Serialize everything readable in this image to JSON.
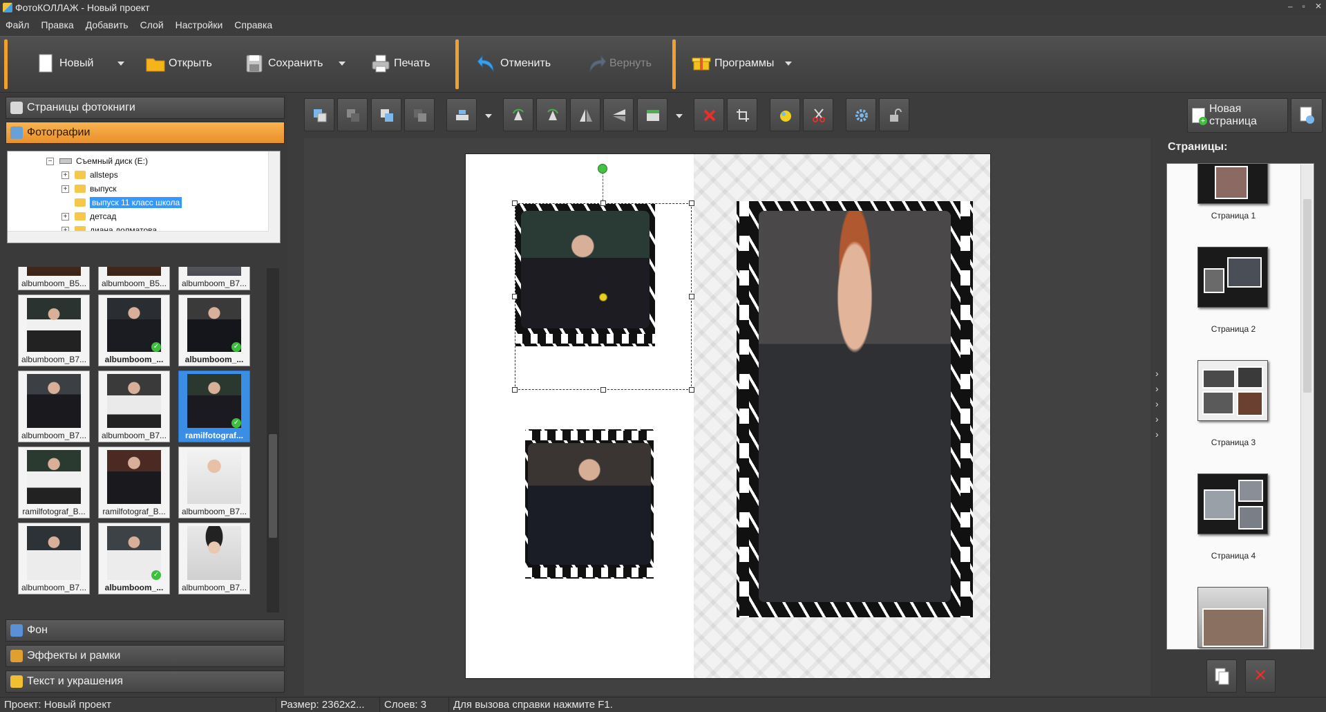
{
  "window": {
    "title": "ФотоКОЛЛАЖ - Новый проект"
  },
  "menu": [
    "Файл",
    "Правка",
    "Добавить",
    "Слой",
    "Настройки",
    "Справка"
  ],
  "toolbar": {
    "new": "Новый",
    "open": "Открыть",
    "save": "Сохранить",
    "print": "Печать",
    "undo": "Отменить",
    "redo": "Вернуть",
    "programs": "Программы"
  },
  "left_panel": {
    "sections": {
      "pages": "Страницы фотокниги",
      "photos": "Фотографии",
      "background": "Фон",
      "effects": "Эффекты и рамки",
      "text": "Текст и украшения"
    },
    "tree": [
      {
        "label": "Съемный диск (E:)",
        "type": "drive",
        "expand": "−"
      },
      {
        "label": "allsteps",
        "type": "folder",
        "expand": "+"
      },
      {
        "label": "выпуск",
        "type": "folder",
        "expand": "+"
      },
      {
        "label": "выпуск 11 класс школа",
        "type": "folder",
        "expand": "",
        "selected": true
      },
      {
        "label": "детсад",
        "type": "folder",
        "expand": "+"
      },
      {
        "label": "диана долматова",
        "type": "folder",
        "expand": "+"
      }
    ],
    "thumbnails": [
      {
        "caption": "albumboom_B5...",
        "bold": false,
        "checked": false,
        "selected": false
      },
      {
        "caption": "albumboom_B5...",
        "bold": false,
        "checked": false,
        "selected": false
      },
      {
        "caption": "albumboom_B7...",
        "bold": false,
        "checked": false,
        "selected": false
      },
      {
        "caption": "albumboom_B7...",
        "bold": false,
        "checked": false,
        "selected": false
      },
      {
        "caption": "albumboom_...",
        "bold": true,
        "checked": true,
        "selected": false
      },
      {
        "caption": "albumboom_...",
        "bold": true,
        "checked": true,
        "selected": false
      },
      {
        "caption": "albumboom_B7...",
        "bold": false,
        "checked": false,
        "selected": false
      },
      {
        "caption": "albumboom_B7...",
        "bold": false,
        "checked": false,
        "selected": false
      },
      {
        "caption": "ramilfotograf...",
        "bold": true,
        "checked": true,
        "selected": true
      },
      {
        "caption": "ramilfotograf_B...",
        "bold": false,
        "checked": false,
        "selected": false
      },
      {
        "caption": "ramilfotograf_B...",
        "bold": false,
        "checked": false,
        "selected": false
      },
      {
        "caption": "albumboom_B7...",
        "bold": false,
        "checked": false,
        "selected": false
      },
      {
        "caption": "albumboom_B7...",
        "bold": false,
        "checked": false,
        "selected": false
      },
      {
        "caption": "albumboom_...",
        "bold": true,
        "checked": true,
        "selected": false
      },
      {
        "caption": "albumboom_B7...",
        "bold": false,
        "checked": false,
        "selected": false
      }
    ]
  },
  "edit_toolbar": {
    "new_page": "Новая страница"
  },
  "pages_panel": {
    "title": "Страницы:",
    "pages": [
      "Страница 1",
      "Страница 2",
      "Страница 3",
      "Страница 4"
    ]
  },
  "statusbar": {
    "project": "Проект:  Новый проект",
    "size": "Размер:  2362x2...",
    "layers": "Слоев:  3",
    "hint": "Для вызова справки нажмите F1."
  },
  "colors": {
    "accent": "#f0a030",
    "selection": "#3399ff",
    "check": "#3cbf3c"
  }
}
